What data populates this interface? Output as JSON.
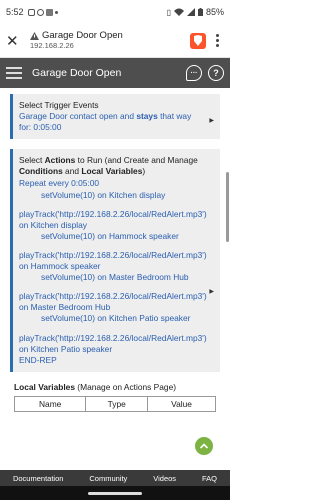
{
  "status_bar": {
    "time": "5:52",
    "battery": "85%"
  },
  "browser": {
    "page_title": "Garage Door Open",
    "url": "192.168.2.26"
  },
  "app_bar": {
    "title": "Garage Door Open"
  },
  "trigger_card": {
    "heading": "Select Trigger Events",
    "text_before": "Garage Door contact open and ",
    "text_bold": "stays",
    "text_after": " that way for: 0:05:00"
  },
  "actions_card": {
    "h_part1": "Select ",
    "h_bold1": "Actions",
    "h_part2": " to Run (and Create and Manage ",
    "h_bold2": "Conditions",
    "h_part3": " and ",
    "h_bold3": "Local Variables",
    "h_part4": ")",
    "lines": [
      "Repeat every 0:05:00",
      "setVolume(10) on Kitchen display",
      "playTrack('http://192.168.2.26/local/RedAlert.mp3')",
      "on Kitchen display",
      "setVolume(10) on Hammock speaker",
      "playTrack('http://192.168.2.26/local/RedAlert.mp3')",
      "on Hammock speaker",
      "setVolume(10) on Master Bedroom Hub",
      "playTrack('http://192.168.2.26/local/RedAlert.mp3')",
      "on Master Bedroom Hub",
      "setVolume(10) on Kitchen Patio speaker",
      "playTrack('http://192.168.2.26/local/RedAlert.mp3')",
      "on Kitchen Patio speaker",
      "END-REP"
    ]
  },
  "local_vars": {
    "label": "Local Variables",
    "note": " (Manage on Actions Page)",
    "columns": [
      "Name",
      "Type",
      "Value"
    ]
  },
  "footer": {
    "links": [
      "Documentation",
      "Community",
      "Videos",
      "FAQ"
    ]
  },
  "colors": {
    "accent_blue": "#2a5fb0",
    "app_bar": "#4e4e4e",
    "fab_green": "#7cb342",
    "brave_orange": "#fb542b"
  }
}
